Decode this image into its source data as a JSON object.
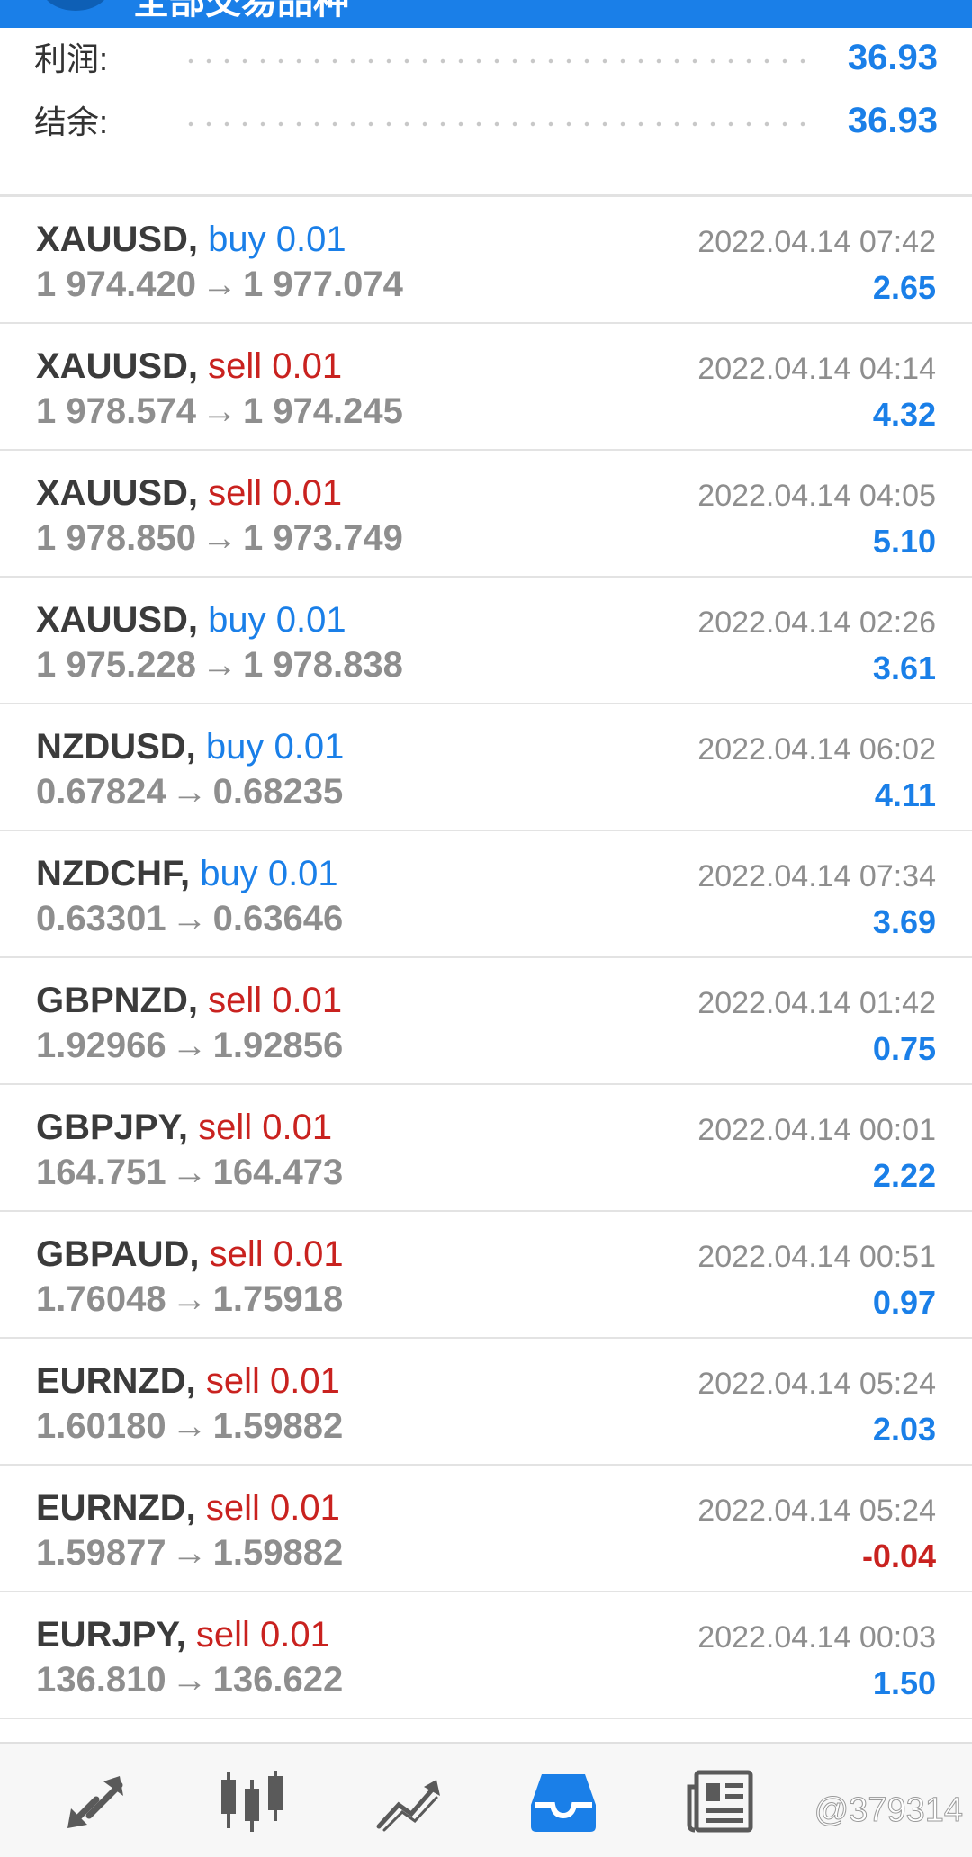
{
  "header": {
    "title": "全部交易品种"
  },
  "summary": {
    "profit_label": "利润:",
    "profit_value": "36.93",
    "balance_label": "结余:",
    "balance_value": "36.93"
  },
  "trades": [
    {
      "symbol": "XAUUSD,",
      "side": "buy 0.01",
      "type": "buy",
      "open": "1 974.420",
      "close": "1 977.074",
      "time": "2022.04.14 07:42",
      "profit": "2.65"
    },
    {
      "symbol": "XAUUSD,",
      "side": "sell 0.01",
      "type": "sell",
      "open": "1 978.574",
      "close": "1 974.245",
      "time": "2022.04.14 04:14",
      "profit": "4.32"
    },
    {
      "symbol": "XAUUSD,",
      "side": "sell 0.01",
      "type": "sell",
      "open": "1 978.850",
      "close": "1 973.749",
      "time": "2022.04.14 04:05",
      "profit": "5.10"
    },
    {
      "symbol": "XAUUSD,",
      "side": "buy 0.01",
      "type": "buy",
      "open": "1 975.228",
      "close": "1 978.838",
      "time": "2022.04.14 02:26",
      "profit": "3.61"
    },
    {
      "symbol": "NZDUSD,",
      "side": "buy 0.01",
      "type": "buy",
      "open": "0.67824",
      "close": "0.68235",
      "time": "2022.04.14 06:02",
      "profit": "4.11"
    },
    {
      "symbol": "NZDCHF,",
      "side": "buy 0.01",
      "type": "buy",
      "open": "0.63301",
      "close": "0.63646",
      "time": "2022.04.14 07:34",
      "profit": "3.69"
    },
    {
      "symbol": "GBPNZD,",
      "side": "sell 0.01",
      "type": "sell",
      "open": "1.92966",
      "close": "1.92856",
      "time": "2022.04.14 01:42",
      "profit": "0.75"
    },
    {
      "symbol": "GBPJPY,",
      "side": "sell 0.01",
      "type": "sell",
      "open": "164.751",
      "close": "164.473",
      "time": "2022.04.14 00:01",
      "profit": "2.22"
    },
    {
      "symbol": "GBPAUD,",
      "side": "sell 0.01",
      "type": "sell",
      "open": "1.76048",
      "close": "1.75918",
      "time": "2022.04.14 00:51",
      "profit": "0.97"
    },
    {
      "symbol": "EURNZD,",
      "side": "sell 0.01",
      "type": "sell",
      "open": "1.60180",
      "close": "1.59882",
      "time": "2022.04.14 05:24",
      "profit": "2.03"
    },
    {
      "symbol": "EURNZD,",
      "side": "sell 0.01",
      "type": "sell",
      "open": "1.59877",
      "close": "1.59882",
      "time": "2022.04.14 05:24",
      "profit": "-0.04"
    },
    {
      "symbol": "EURJPY,",
      "side": "sell 0.01",
      "type": "sell",
      "open": "136.810",
      "close": "136.622",
      "time": "2022.04.14 00:03",
      "profit": "1.50"
    }
  ],
  "arrow": "→",
  "tabs": [
    {
      "icon": "quotes-arrows-icon",
      "active": false
    },
    {
      "icon": "candlestick-chart-icon",
      "active": false
    },
    {
      "icon": "trade-chart-icon",
      "active": false
    },
    {
      "icon": "history-inbox-icon",
      "active": true
    },
    {
      "icon": "news-icon",
      "active": false
    }
  ],
  "watermark": "@379314",
  "colors": {
    "accent": "#1a7fe8",
    "sell": "#c9221f",
    "muted": "#8e8e8e",
    "tab_inactive": "#5a5a5a"
  }
}
